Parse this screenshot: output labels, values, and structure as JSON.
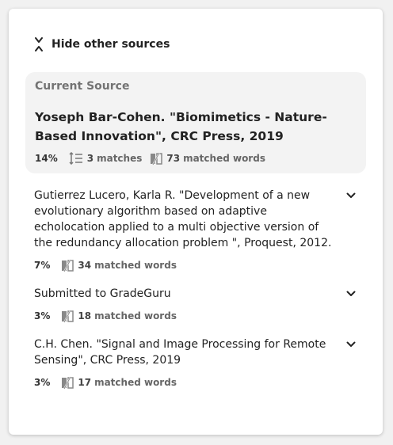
{
  "toggle": {
    "label": "Hide other sources",
    "icon": "collapse-arrows-icon"
  },
  "current_source": {
    "heading": "Current Source",
    "title": "Yoseph Bar-Cohen. \"Biomimetics - Nature-Based Innovation\", CRC Press, 2019",
    "percent": "14%",
    "matches_count": "3",
    "matches_label": "matches",
    "words_count": "73",
    "words_label": "matched words"
  },
  "sources": [
    {
      "title": "Gutierrez Lucero, Karla R. \"Development of a new evolutionary algorithm based on adaptive echolocation applied to a multi objective version of the redundancy allocation problem \", Proquest, 2012.",
      "percent": "7%",
      "words_count": "34",
      "words_label": "matched words"
    },
    {
      "title": "Submitted to GradeGuru",
      "percent": "3%",
      "words_count": "18",
      "words_label": "matched words"
    },
    {
      "title": "C.H. Chen. \"Signal and Image Processing for Remote Sensing\", CRC Press, 2019",
      "percent": "3%",
      "words_count": "17",
      "words_label": "matched words"
    }
  ],
  "colors": {
    "background": "#f1f1f1",
    "card": "#ffffff",
    "current_bg": "#f3f3f3",
    "muted_text": "#737373",
    "text": "#222222"
  }
}
